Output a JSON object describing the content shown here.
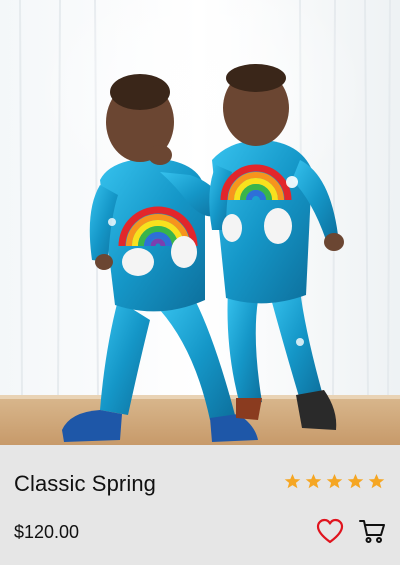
{
  "product": {
    "image_alt": "Two toddlers in shiny blue rainbow jumpsuits",
    "title": "Classic Spring",
    "price": "$120.00",
    "rating": 5,
    "rating_max": 5
  },
  "icons": {
    "star": "star-icon",
    "favorite": "heart-outline-icon",
    "cart": "shopping-cart-icon"
  },
  "colors": {
    "panel_bg": "#e6e6e6",
    "star": "#f5a623",
    "heart": "#e0141e",
    "text": "#111111",
    "suit": "#1aa3d4"
  }
}
